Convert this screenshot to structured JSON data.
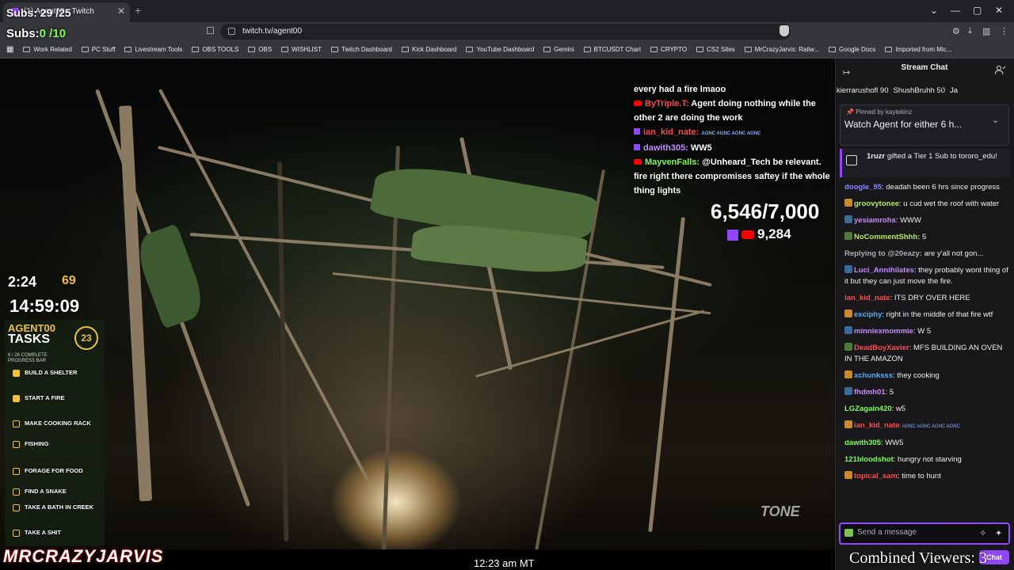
{
  "browser": {
    "tab_title": "(1) Agent00 - Twitch",
    "url": "twitch.tv/agent00",
    "bookmarks": [
      "Work Related",
      "PC Stuff",
      "Livestream Tools",
      "OBS TOOLS",
      "OBS",
      "WISHLIST",
      "Twitch Dashboard",
      "Kick Dashboard",
      "YouTube Dashboard",
      "Gemini",
      "BTCUSDT Chart",
      "CRYPTO",
      "CS2 Sites",
      "MrCrazyJarvis: Railw...",
      "Google Docs",
      "Imported from Mic..."
    ]
  },
  "overlay": {
    "subs_label": "Subs: 29 /25",
    "subs2_label": "Subs:",
    "subs2_value": "0 /10",
    "goal_main": "6,546/7,000",
    "goal_sub": "9,284",
    "timer": "2:24",
    "timer_small": "69",
    "clock": "14:59:09",
    "tasks_title_1": "AGENT00",
    "tasks_title_2": "TASKS",
    "tasks_circle": "23",
    "tasks_progress_1": "6 / 26 COMPLETE",
    "tasks_progress_2": "PROGRESS BAR",
    "tasks": [
      "BUILD A SHELTER",
      "START A FIRE",
      "MAKE COOKING RACK",
      "FISHING",
      "FORAGE FOR FOOD",
      "FIND A SNAKE",
      "TAKE A BATH IN CREEK",
      "TAKE A SHIT"
    ],
    "brand": "MRCRAZYJARVIS",
    "time": "12:23 am MT",
    "watermark": "TONE",
    "combined_viewers": "Combined Viewers: 3"
  },
  "overlay_chat": [
    {
      "user": "",
      "text": "every had a fire lmaoo",
      "platform": "none"
    },
    {
      "user": "ByTriple.T:",
      "text": "Agent doing nothing while the other 2 are doing the work",
      "platform": "yt",
      "color": "#ff4a4a"
    },
    {
      "user": "ian_kid_nate:",
      "text": "AGNC AGNC AGNC AGNC",
      "platform": "tw",
      "color": "#ff4a4a"
    },
    {
      "user": "dawith305:",
      "text": "WW5",
      "platform": "tw",
      "color": "#c68bff"
    },
    {
      "user": "MayvenFalls:",
      "text": "@Unheard_Tech be relevant. fire right there compromises saftey if the whole thing lights",
      "platform": "yt",
      "color": "#7cff4f"
    }
  ],
  "chat": {
    "title": "Stream Chat",
    "leaderboard": [
      "kierrarushofl 90",
      "ShushBruhh 50",
      "Ja"
    ],
    "pinned_by": "Pinned by kaytekinz",
    "pinned_msg": "Watch Agent for either 6 h...",
    "gift_user": "1ruzr",
    "gift_text": "gifted a Tier 1 Sub to tororo_edu!",
    "messages": [
      {
        "user": "doogle_95",
        "text": ": deadah been 6 hrs since progress",
        "color": "#8a8aff"
      },
      {
        "user": "groovytonee",
        "text": ": u cud wet the roof with water",
        "color": "#b5e853"
      },
      {
        "user": "yesiamrohs",
        "text": ": WWW",
        "color": "#c68bff"
      },
      {
        "user": "NoCommentShhh:",
        "text": " 5",
        "color": "#b5e853"
      },
      {
        "user": "Replying to @20eazy:",
        "text": " are y'all not gon...",
        "color": "#adadb8"
      },
      {
        "user": "Luci_Annihilates",
        "text": ": they probably wont thing of it but they can just move the fire.",
        "color": "#c68bff"
      },
      {
        "user": "ian_kid_nate",
        "text": ": ITS DRY OVER HERE",
        "color": "#ff4a4a"
      },
      {
        "user": "exciphy",
        "text": ": right in the middle of that fire wtf",
        "color": "#4fb0ff"
      },
      {
        "user": "minniexmommie",
        "text": ": W 5",
        "color": "#c68bff"
      },
      {
        "user": "DeadBoyXavier",
        "text": ": MFS BUILDING AN OVEN IN THE AMAZON",
        "color": "#ff4a4a"
      },
      {
        "user": "xchunksss",
        "text": ": they cooking",
        "color": "#4fb0ff"
      },
      {
        "user": "fhdmh01",
        "text": ": 5",
        "color": "#c68bff"
      },
      {
        "user": "LGZagain420",
        "text": ": w5",
        "color": "#7cff4f"
      },
      {
        "user": "ian_kid_nate",
        "text": ": AGNC AGNC AGNC AGNC",
        "color": "#ff4a4a"
      },
      {
        "user": "dawith305",
        "text": ": WW5",
        "color": "#7cff4f"
      },
      {
        "user": "121bloodshot",
        "text": ": hungry not starving",
        "color": "#7cff4f"
      },
      {
        "user": "topical_sam",
        "text": ": time to hunt",
        "color": "#ff4a4a"
      }
    ],
    "input_placeholder": "Send a message",
    "chat_button": "Chat"
  },
  "colors": {
    "twitch_purple": "#9146ff",
    "accent_green": "#7cff4f",
    "gold": "#f0c040"
  }
}
